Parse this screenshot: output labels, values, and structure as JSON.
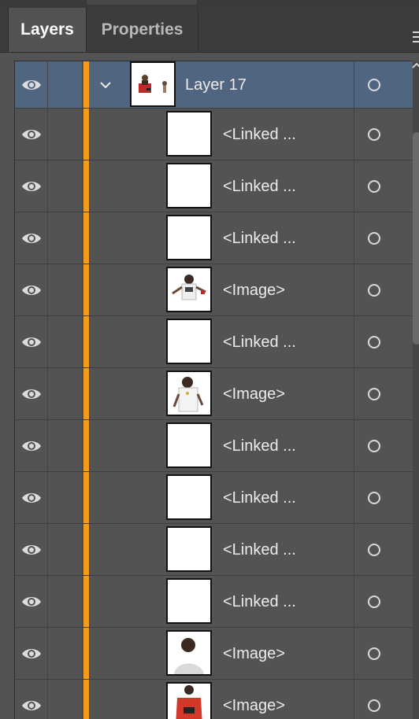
{
  "tabs": {
    "active": "Layers",
    "inactive": "Properties"
  },
  "icons": {
    "visibility": "eye-icon",
    "expand": "chevron-down-icon",
    "target": "target-circle-icon",
    "panel_menu": "hamburger-menu-icon"
  },
  "colors": {
    "layer_color": "#f49a1d",
    "selected_row": "#50657f",
    "panel_bg": "#535353"
  },
  "group": {
    "label": "Layer 17",
    "thumbnail": "group-thumbnail"
  },
  "items": [
    {
      "label": "<Linked ...",
      "thumbnail": "blank"
    },
    {
      "label": "<Linked ...",
      "thumbnail": "blank"
    },
    {
      "label": "<Linked ...",
      "thumbnail": "blank"
    },
    {
      "label": "<Image>",
      "thumbnail": "person-with-arms-out"
    },
    {
      "label": "<Linked ...",
      "thumbnail": "blank"
    },
    {
      "label": "<Image>",
      "thumbnail": "person-white-shirt"
    },
    {
      "label": "<Linked ...",
      "thumbnail": "blank"
    },
    {
      "label": "<Linked ...",
      "thumbnail": "blank"
    },
    {
      "label": "<Linked ...",
      "thumbnail": "blank"
    },
    {
      "label": "<Linked ...",
      "thumbnail": "blank"
    },
    {
      "label": "<Image>",
      "thumbnail": "person-portrait"
    },
    {
      "label": "<Image>",
      "thumbnail": "red-vest"
    }
  ]
}
